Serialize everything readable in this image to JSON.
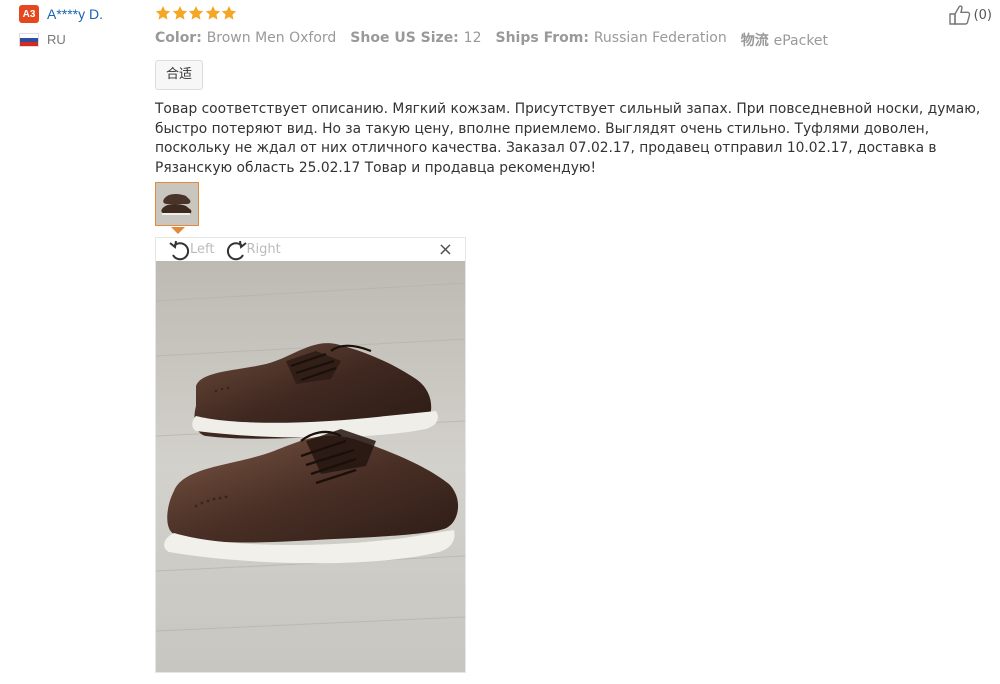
{
  "reviewer": {
    "level_badge": "A3",
    "name": "A****y D.",
    "country_code": "RU",
    "badge_color": "#e5471e"
  },
  "review": {
    "rating": 5,
    "rating_max": 5,
    "star_color": "#f5a623",
    "attributes": [
      {
        "key": "Color:",
        "value": "Brown Men Oxford"
      },
      {
        "key": "Shoe US Size:",
        "value": "12"
      },
      {
        "key": "Ships From:",
        "value": "Russian Federation"
      },
      {
        "key": "物流",
        "value": "ePacket"
      }
    ],
    "tag": "合适",
    "text": "Товар соответствует описанию. Мягкий кожзам. Присутствует сильный запах. При повседневной носки, думаю, быстро потеряют вид. Но за такую цену, вполне приемлемо. Выглядят очень стильно. Туфлями доволен, поскольку не ждал от них отличного качества. Заказал 07.02.17, продавец отправил 10.02.17, доставка в Рязанскую область 25.02.17 Товар и продавца рекомендую!"
  },
  "viewer": {
    "rotate_left_label": "Left",
    "rotate_right_label": "Right",
    "close_label": "×"
  },
  "helpful": {
    "count_label": "(0)"
  },
  "icons": {
    "thumbs_up": "thumbs-up-icon",
    "rotate_left": "rotate-left-icon",
    "rotate_right": "rotate-right-icon",
    "close": "close-icon",
    "star": "star-icon",
    "flag": "flag-icon"
  }
}
